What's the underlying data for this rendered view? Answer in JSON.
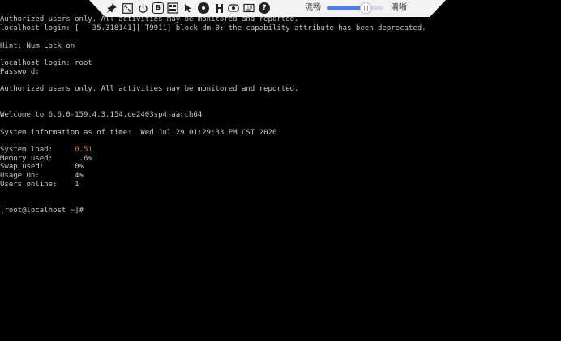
{
  "console": {
    "lines": [
      {
        "text": "Authorized users only. All activities may be monitored and reported."
      },
      {
        "text": "localhost login: [   35.318141][ T9911] block dm-0: the capability attribute has been deprecated."
      },
      {
        "text": ""
      },
      {
        "text": "Hint: Num Lock on"
      },
      {
        "text": ""
      },
      {
        "text": "localhost login: root"
      },
      {
        "text": "Password:"
      },
      {
        "text": ""
      },
      {
        "text": "Authorized users only. All activities may be monitored and reported."
      },
      {
        "text": ""
      },
      {
        "text": ""
      },
      {
        "text": "Welcome to 6.6.0-159.4.3.154.oe2403sp4.aarch64"
      },
      {
        "text": ""
      },
      {
        "text": "System information as of time:  Wed Jul 29 01:29:33 PM CST 2026"
      },
      {
        "text": ""
      },
      {
        "text": "System load:     ",
        "value": "0.51",
        "highlight": true
      },
      {
        "text": "Memory used:      .6%"
      },
      {
        "text": "Swap used:       0%"
      },
      {
        "text": "Usage On:        4%"
      },
      {
        "text": "Users online:    1"
      },
      {
        "text": ""
      },
      {
        "text": ""
      },
      {
        "text": "[root@localhost ~]#"
      }
    ],
    "colors": {
      "foreground": "#c8c8c8",
      "highlight": "#e08a1e",
      "background": "#000000"
    }
  },
  "toolbar": {
    "icons": [
      "pin-icon",
      "fullscreen-icon",
      "power-icon",
      "bold-b-icon",
      "keyboard-combo-icon",
      "mouse-icon",
      "disc-icon",
      "shortcut-icon",
      "record-icon",
      "keyboard-icon",
      "help-icon"
    ],
    "bold_icon_text": "B",
    "help_icon_text": "?",
    "slider_left_label": "流畅",
    "slider_right_label": "清晰",
    "quality_level": 0.6
  }
}
